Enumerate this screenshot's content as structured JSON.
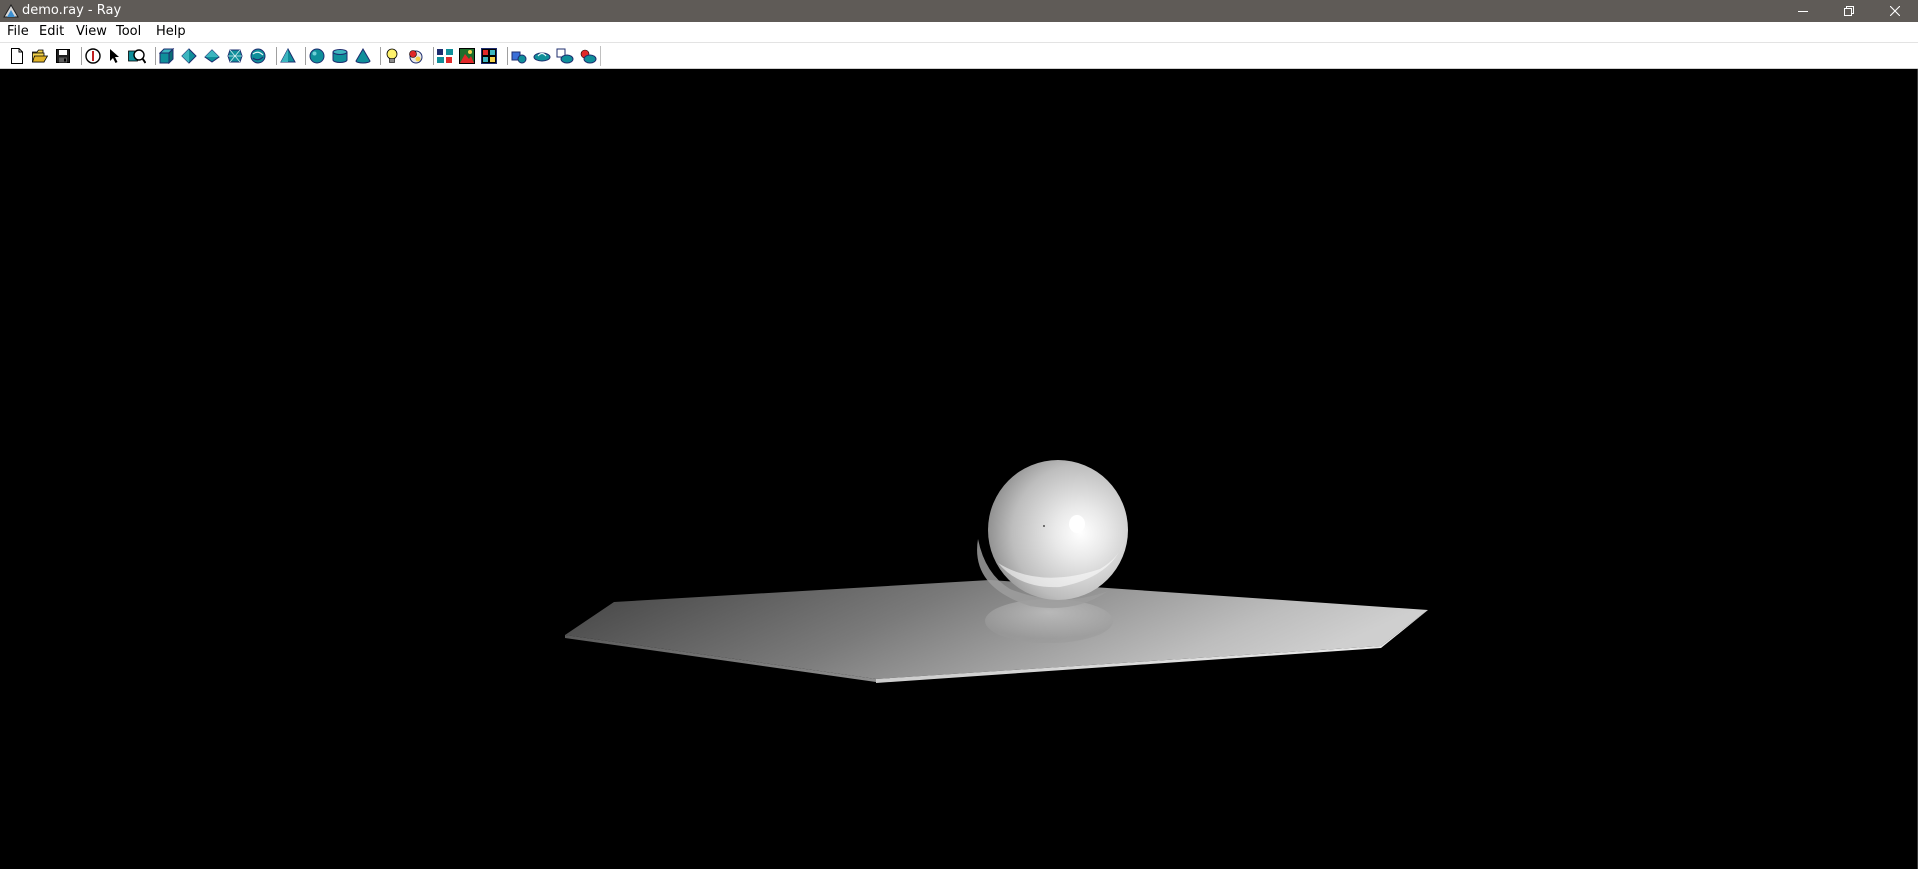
{
  "window": {
    "title": "demo.ray - Ray",
    "controls": [
      "minimize-icon",
      "restore-icon",
      "close-icon"
    ]
  },
  "menu": {
    "items": [
      "File",
      "Edit",
      "View",
      "Tool",
      "Help"
    ]
  },
  "toolbar": {
    "groups": [
      [
        "new-file-icon",
        "open-folder-icon",
        "save-icon"
      ],
      [
        "info-icon",
        "select-arrow-icon",
        "zoom-icon"
      ],
      [
        "cube-icon",
        "diamond-icon",
        "prism-icon",
        "mesh-icon",
        "torus-icon"
      ],
      [
        "pyramid-icon"
      ],
      [
        "sphere-icon",
        "cylinder-icon",
        "cone-icon"
      ],
      [
        "light-bulb-icon",
        "spot-light-icon"
      ],
      [
        "camera-view-icon",
        "render-icon",
        "image-icon"
      ],
      [
        "rotate-icon",
        "move-icon",
        "scale-icon",
        "material-icon"
      ]
    ]
  },
  "scene": {
    "background": "#000000",
    "objects": [
      "plane",
      "sphere"
    ],
    "plane_color": "#9c9c9c",
    "sphere_color": "#ffffff"
  },
  "colors": {
    "titlebar": "#5f5b57",
    "icon_teal": "#0f8f9a",
    "icon_navy": "#1d2c6e"
  }
}
